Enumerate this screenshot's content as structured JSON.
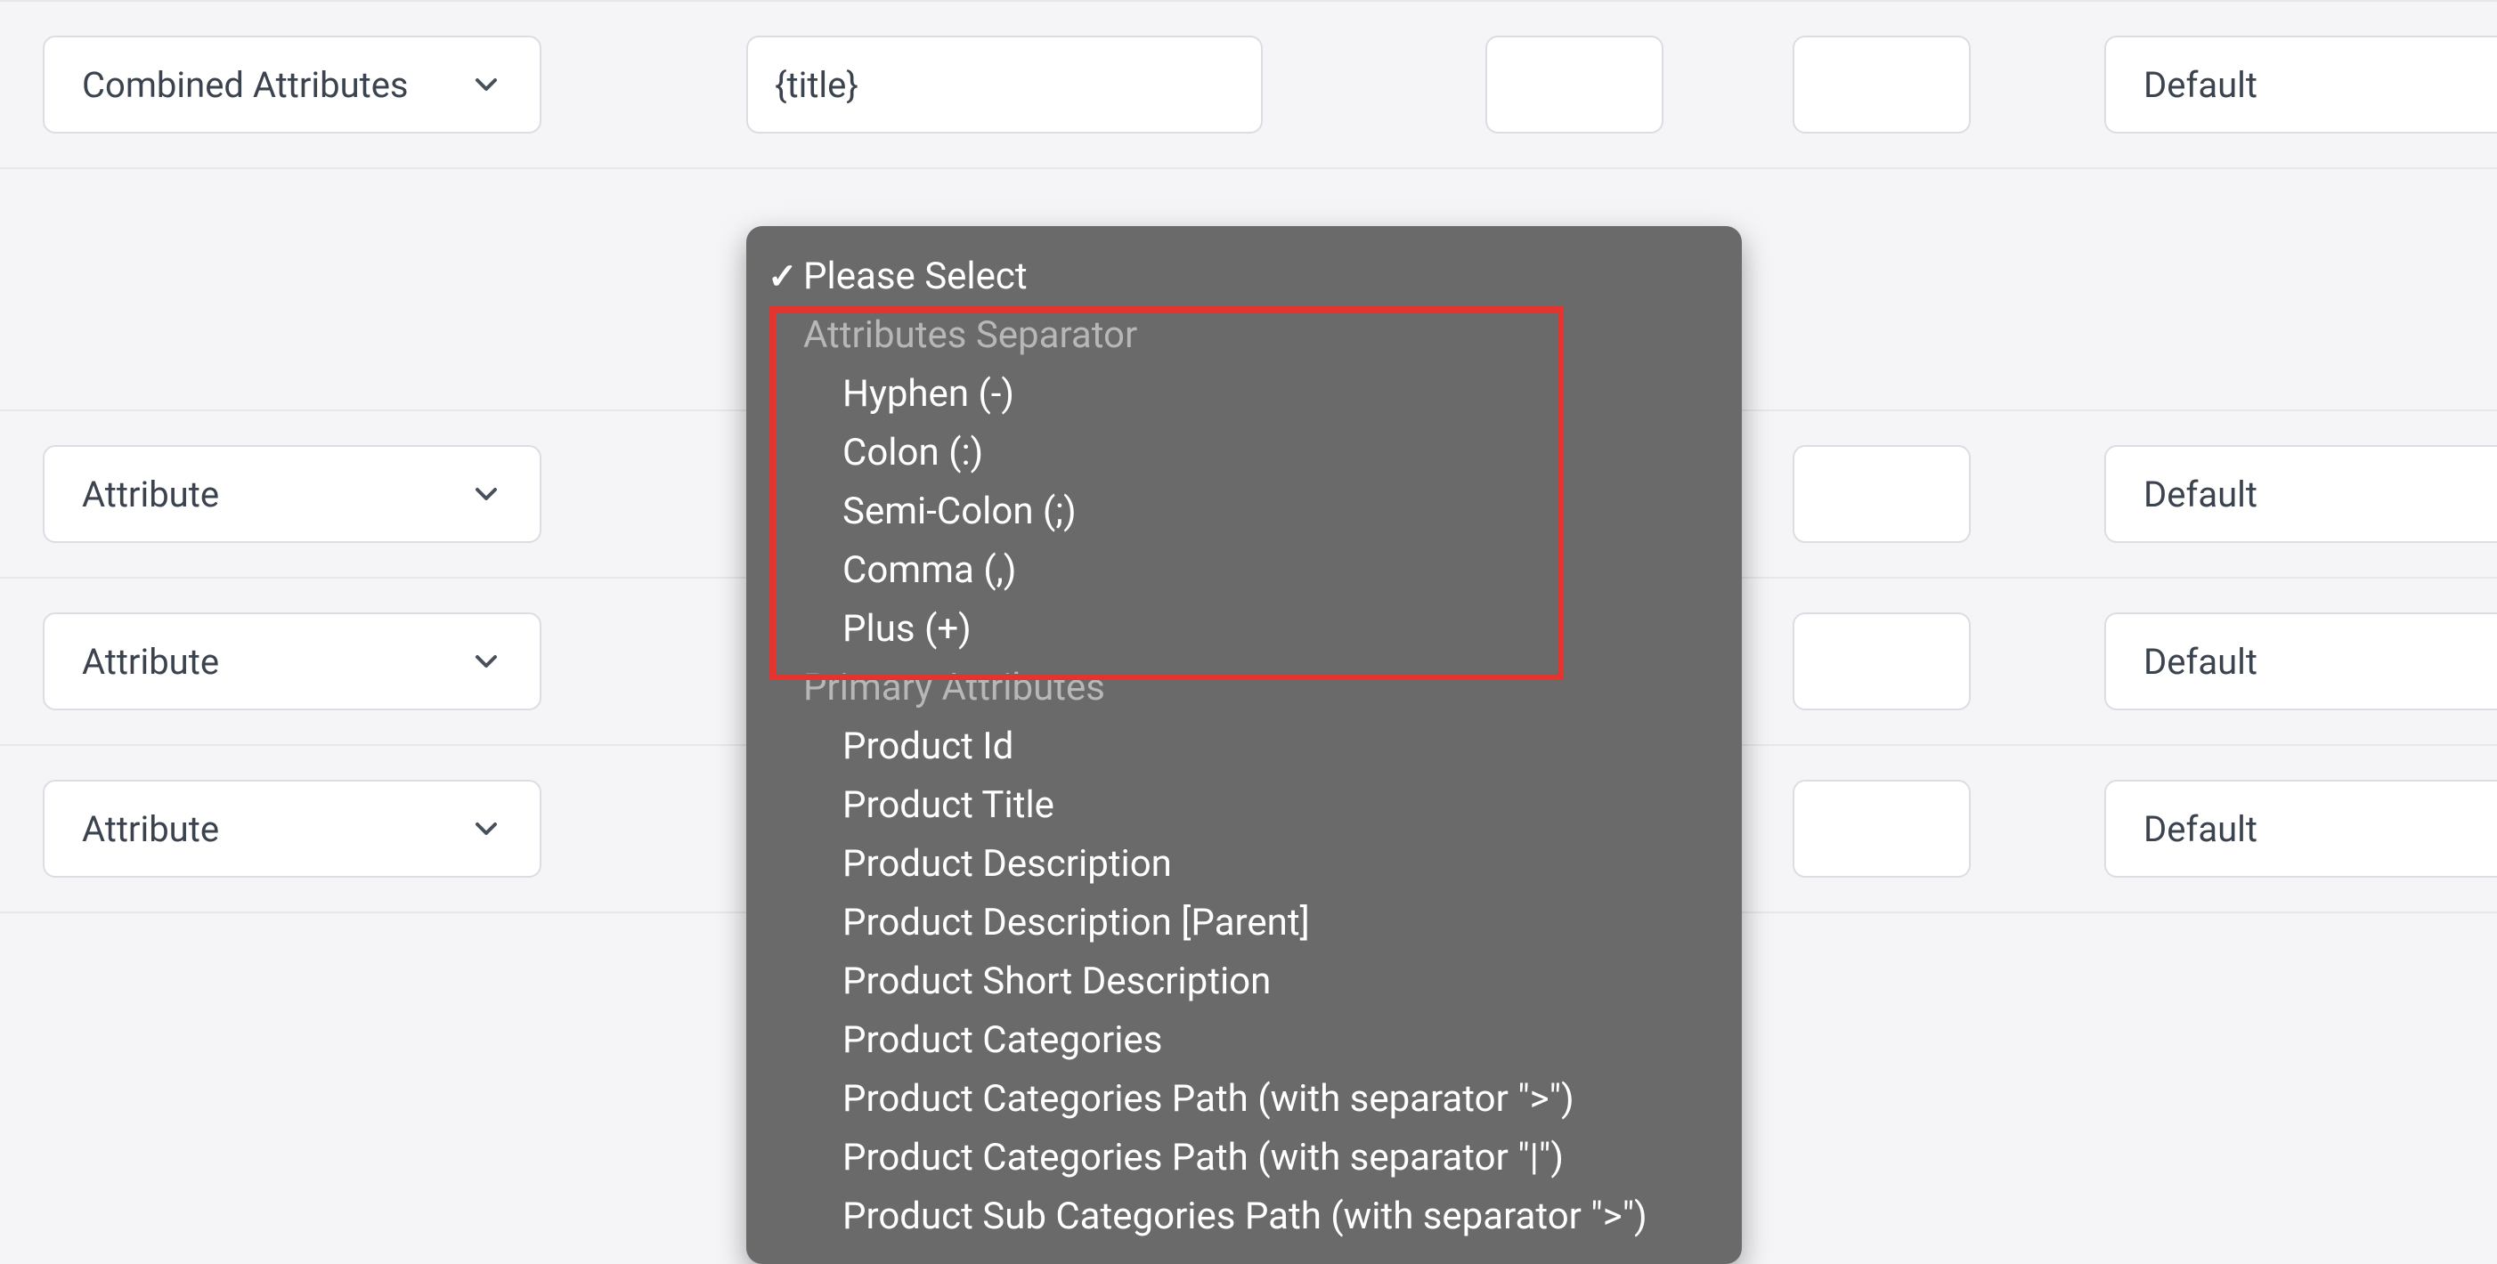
{
  "row1": {
    "attr_label": "Combined Attributes",
    "title_value": "{title}",
    "default_label": "Default"
  },
  "row2": {
    "attr_label": "Attribute",
    "default_label": "Default"
  },
  "row3": {
    "attr_label": "Attribute",
    "default_label": "Default"
  },
  "row4": {
    "attr_label": "Attribute",
    "default_label": "Default"
  },
  "dropdown": {
    "selected": "Please Select",
    "group1_label": "Attributes Separator",
    "hyphen": "Hyphen (-)",
    "colon": "Colon (:)",
    "semicolon": "Semi-Colon (;)",
    "comma": "Comma (,)",
    "plus": "Plus (+)",
    "group2_label": "Primary Attributes",
    "product_id": "Product Id",
    "product_title": "Product Title",
    "product_description": "Product Description",
    "product_description_parent": "Product Description [Parent]",
    "product_short_description": "Product Short Description",
    "product_categories": "Product Categories",
    "product_categories_path_gt": "Product Categories Path (with separator \">\")",
    "product_categories_path_pipe": "Product Categories Path (with separator \"|\")",
    "product_sub_categories_path_gt": "Product Sub Categories Path (with separator \">\")"
  }
}
